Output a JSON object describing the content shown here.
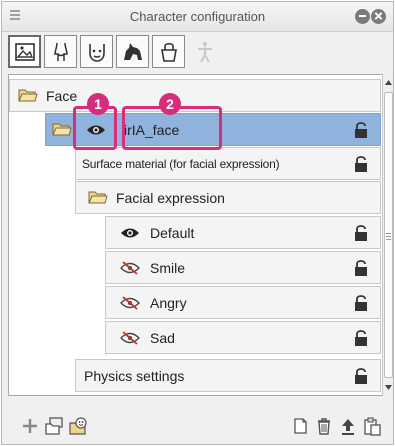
{
  "window": {
    "title": "Character configuration"
  },
  "tabs": [
    {
      "icon": "image-frame-icon",
      "active": true
    },
    {
      "icon": "body-outline-icon",
      "active": false
    },
    {
      "icon": "face-icon",
      "active": false
    },
    {
      "icon": "animal-icon",
      "active": false
    },
    {
      "icon": "accessory-icon",
      "active": false
    },
    {
      "icon": "mannequin-icon",
      "active": false,
      "disabled": true
    }
  ],
  "tree": {
    "items": [
      {
        "label": "Face",
        "type": "folder"
      },
      {
        "label": "irIA_face",
        "type": "layer",
        "selected": true
      },
      {
        "label": "Surface material (for facial expression)",
        "type": "setting"
      },
      {
        "label": "Facial expression",
        "type": "folder"
      },
      {
        "label": "Default",
        "type": "expression",
        "visible": true
      },
      {
        "label": "Smile",
        "type": "expression",
        "visible": false
      },
      {
        "label": "Angry",
        "type": "expression",
        "visible": false
      },
      {
        "label": "Sad",
        "type": "expression",
        "visible": false
      },
      {
        "label": "Physics settings",
        "type": "setting"
      }
    ]
  },
  "callouts": [
    {
      "number": "1",
      "target": "visibility-toggle"
    },
    {
      "number": "2",
      "target": "layer-name"
    }
  ],
  "bottombar": {
    "left": [
      "add-icon",
      "add-folder-icon",
      "add-expression-icon"
    ],
    "right": [
      "new-page-icon",
      "delete-icon",
      "upload-icon",
      "paste-icon"
    ]
  },
  "colors": {
    "accent": "#d62e7c",
    "selection": "#8fb3dc"
  }
}
